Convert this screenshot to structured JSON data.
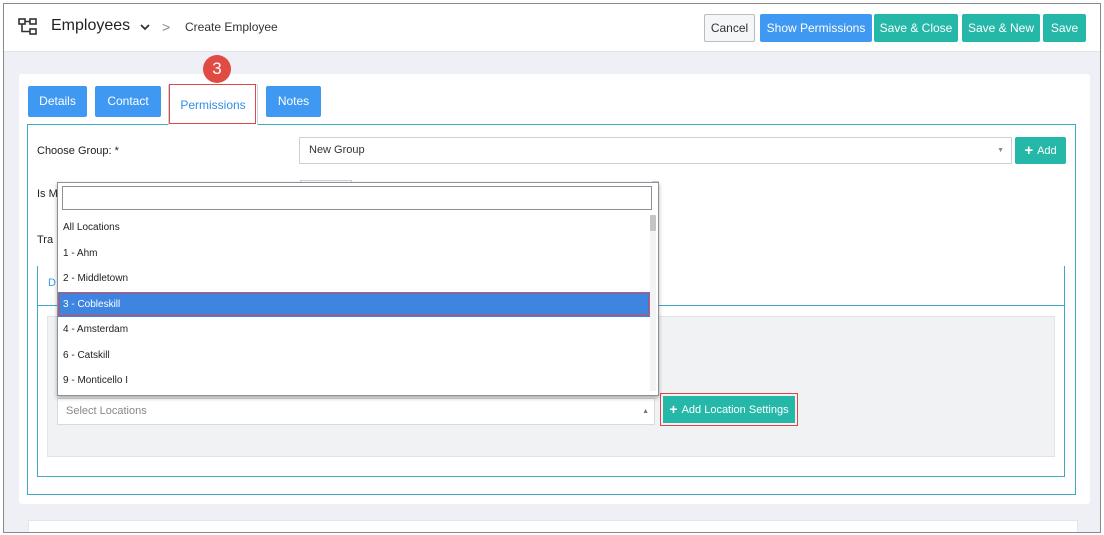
{
  "header": {
    "title": "Employees",
    "separator": ">",
    "breadcrumb": "Create Employee",
    "buttons": {
      "cancel": "Cancel",
      "show_permissions": "Show Permissions",
      "save_close": "Save & Close",
      "save_new": "Save & New",
      "save": "Save"
    }
  },
  "step_badge": "3",
  "tabs": [
    {
      "label": "Details",
      "active": false
    },
    {
      "label": "Contact",
      "active": false
    },
    {
      "label": "Permissions",
      "active": true
    },
    {
      "label": "Notes",
      "active": false
    }
  ],
  "form": {
    "choose_group_label": "Choose Group: *",
    "choose_group_value": "New Group",
    "add_label": "Add",
    "is_m_label": "Is M",
    "tra_label": "Tra",
    "subtab_label": "D",
    "select_locations_placeholder": "Select Locations",
    "add_location_settings": "Add Location Settings"
  },
  "dropdown": {
    "search_value": "",
    "items": [
      "All Locations",
      "1 - Ahm",
      "2 - Middletown",
      "3 - Cobleskill",
      "4 - Amsterdam",
      "6 - Catskill",
      "9 - Monticello I"
    ],
    "selected": "3 - Cobleskill"
  },
  "colors": {
    "primary_blue": "#3f99f2",
    "teal": "#25b8a8",
    "highlight_red": "#e0454a",
    "selected_item": "#3d85e0"
  }
}
